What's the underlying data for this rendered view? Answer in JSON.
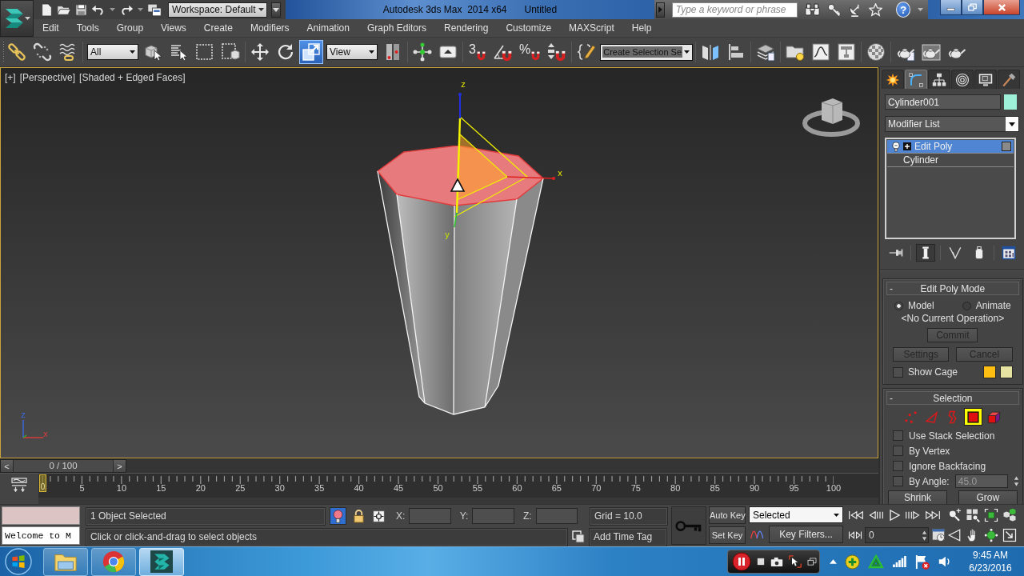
{
  "title_bar": {
    "workspace": "Workspace: Default",
    "app_title": "Autodesk 3ds Max  2014 x64",
    "document": "Untitled",
    "search": {
      "placeholder": "Type a keyword or phrase"
    },
    "help": "?"
  },
  "menu": [
    "Edit",
    "Tools",
    "Group",
    "Views",
    "Create",
    "Modifiers",
    "Animation",
    "Graph Editors",
    "Rendering",
    "Customize",
    "MAXScript",
    "Help"
  ],
  "toolbar": [
    [
      {
        "kind": "link",
        "selected": false
      },
      {
        "kind": "unlink",
        "selected": false
      },
      {
        "kind": "bind",
        "selected": false
      }
    ],
    [
      {
        "kind": "dropdown",
        "value": "All"
      },
      {
        "kind": "select",
        "selected": false
      },
      {
        "kind": "select_by_name",
        "selected": false
      },
      {
        "kind": "region",
        "selected": false
      },
      {
        "kind": "crossing",
        "selected": false
      }
    ],
    [
      {
        "kind": "move",
        "selected": false
      },
      {
        "kind": "rotate",
        "selected": false
      },
      {
        "kind": "scale",
        "selected": true
      },
      {
        "kind": "dropdown",
        "value": "View"
      },
      {
        "kind": "pivot",
        "selected": false
      }
    ],
    [
      {
        "kind": "manipulate",
        "selected": false
      },
      {
        "kind": "shortcut",
        "selected": false
      }
    ],
    [
      {
        "kind": "snap",
        "label": "3",
        "selected": false
      },
      {
        "kind": "angle_snap",
        "selected": false
      },
      {
        "kind": "percent_snap",
        "label": "%",
        "selected": false
      },
      {
        "kind": "spinner_snap",
        "selected": false
      }
    ],
    [
      {
        "kind": "named_sets",
        "selected": false
      },
      {
        "kind": "combo",
        "placeholder": "Create Selection Se"
      }
    ],
    [
      {
        "kind": "mirror",
        "selected": false
      },
      {
        "kind": "align",
        "selected": false
      }
    ],
    [
      {
        "kind": "explorer",
        "selected": false
      }
    ],
    [
      {
        "kind": "layers",
        "selected": false
      },
      {
        "kind": "curve_editor",
        "selected": false
      },
      {
        "kind": "schematic",
        "selected": false
      }
    ],
    [
      {
        "kind": "material",
        "selected": false
      }
    ],
    [
      {
        "kind": "render_setup",
        "selected": false
      },
      {
        "kind": "frame_window",
        "selected": false
      },
      {
        "kind": "render",
        "selected": false
      }
    ]
  ],
  "viewport": {
    "active": true,
    "labels": [
      "[+]",
      "[Perspective]",
      "[Shaded + Edged Faces]"
    ],
    "gizmo_axes": [
      "z",
      "x",
      "y"
    ],
    "world_axes": [
      "z",
      "x"
    ]
  },
  "command_panel": {
    "tabs": [
      {
        "kind": "create",
        "selected": false
      },
      {
        "kind": "modify",
        "selected": true
      },
      {
        "kind": "hierarchy",
        "selected": false
      },
      {
        "kind": "motion",
        "selected": false
      },
      {
        "kind": "display",
        "selected": false
      },
      {
        "kind": "utilities",
        "selected": false
      }
    ],
    "object_name": "Cylinder001",
    "modifier_list": "Modifier List",
    "stack": [
      {
        "kind": "modifier",
        "label": "Edit Poly",
        "selected": true
      },
      {
        "kind": "object",
        "label": "Cylinder",
        "selected": false
      }
    ],
    "stack_tools": [
      {
        "kind": "pin",
        "selected": false
      },
      {
        "kind": "end_result",
        "selected": true
      },
      {
        "kind": "unique",
        "selected": false
      },
      {
        "kind": "remove",
        "selected": false
      },
      {
        "kind": "configure",
        "selected": false
      }
    ],
    "edit_poly_mode": {
      "toggle": "-",
      "title": "Edit Poly Mode",
      "modes": [
        {
          "label": "Model",
          "selected": true
        },
        {
          "label": "Animate",
          "selected": false
        }
      ],
      "operation": "<No Current Operation>",
      "commit": {
        "label": "Commit",
        "disabled": true
      },
      "actions": [
        {
          "label": "Settings",
          "disabled": true
        },
        {
          "label": "Cancel",
          "disabled": true
        }
      ],
      "show_cage": {
        "label": "Show Cage",
        "checked": false
      }
    },
    "selection": {
      "toggle": "-",
      "title": "Selection",
      "levels": [
        {
          "kind": "vertex",
          "selected": false
        },
        {
          "kind": "edge",
          "selected": false
        },
        {
          "kind": "border",
          "selected": false
        },
        {
          "kind": "polygon",
          "selected": true
        },
        {
          "kind": "element",
          "selected": false
        }
      ],
      "options": [
        {
          "kind": "check",
          "label": "Use Stack Selection",
          "checked": false
        },
        {
          "kind": "check",
          "label": "By Vertex",
          "checked": false
        },
        {
          "kind": "check",
          "label": "Ignore Backfacing",
          "checked": false
        },
        {
          "kind": "angle",
          "label": "By Angle:",
          "checked": false,
          "value": "45.0"
        }
      ],
      "buttons": [
        "Shrink",
        "Grow"
      ]
    }
  },
  "time_slider": {
    "prev": "<",
    "label": "0 / 100",
    "next": ">",
    "level": 0
  },
  "track_bar": {
    "current_frame": "0",
    "labels": [
      "5",
      "10",
      "15",
      "20",
      "25",
      "30",
      "35",
      "40",
      "45",
      "50",
      "55",
      "60",
      "65",
      "70",
      "75",
      "80",
      "85",
      "90",
      "95",
      "100"
    ]
  },
  "status": {
    "listener": "Welcome to M",
    "selection_info": "1 Object Selected",
    "toggles": [
      {
        "kind": "isolate",
        "selected": true
      },
      {
        "kind": "lock",
        "selected": false
      },
      {
        "kind": "offset",
        "selected": false
      }
    ],
    "coords": [
      "X:",
      "Y:",
      "Z:"
    ],
    "grid": "Grid = 10.0",
    "prompt": "Click or click-and-drag to select objects",
    "time_tag": "Add Time Tag"
  },
  "animation": {
    "auto_key": {
      "label": "Auto Key",
      "selected": false
    },
    "set_key": {
      "label": "Set Key",
      "selected": false
    },
    "key_mode": "Selected",
    "key_filters": "Key Filters...",
    "frame": "0"
  },
  "taskbar": {
    "apps": [
      {
        "kind": "folder",
        "selected": false
      },
      {
        "kind": "browser",
        "selected": false
      },
      {
        "kind": "max",
        "selected": true
      }
    ],
    "time": "9:45 AM",
    "date": "6/23/2016"
  }
}
